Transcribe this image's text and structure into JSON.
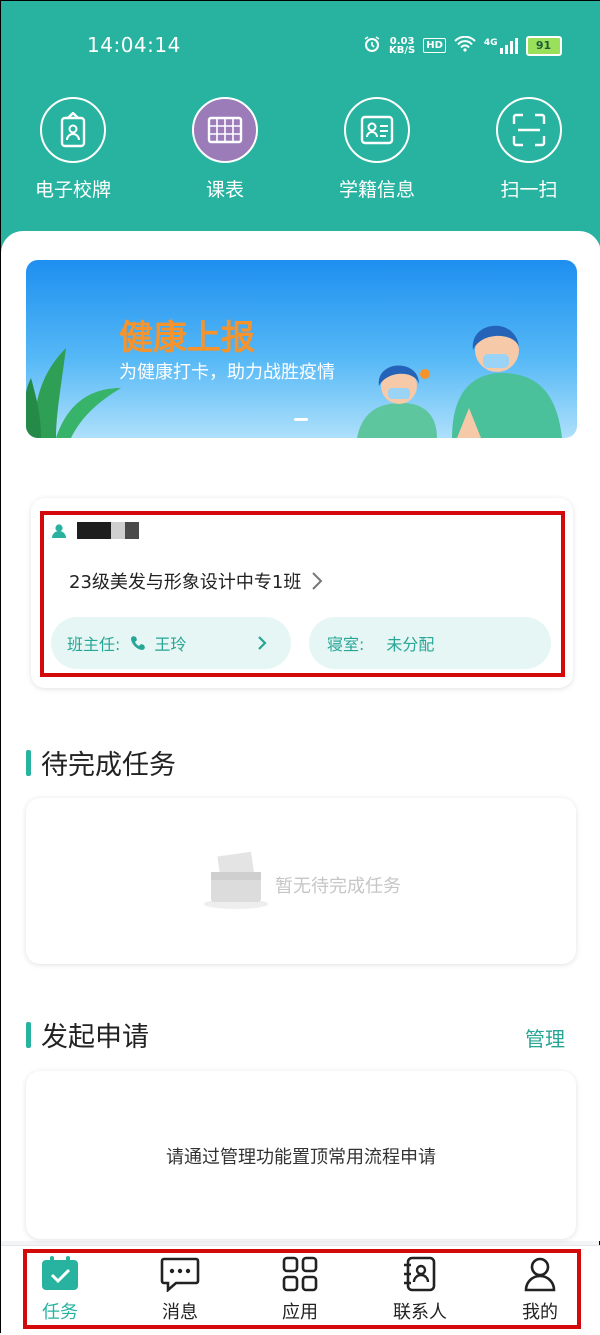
{
  "status_bar": {
    "time": "14:04:14",
    "net_speed_value": "0.03",
    "net_speed_unit": "KB/S",
    "hd": "HD",
    "network": "4G",
    "battery": "91"
  },
  "quick_actions": [
    {
      "label": "电子校牌",
      "icon": "id-badge-icon"
    },
    {
      "label": "课表",
      "icon": "timetable-icon"
    },
    {
      "label": "学籍信息",
      "icon": "student-record-icon"
    },
    {
      "label": "扫一扫",
      "icon": "scan-icon"
    }
  ],
  "banner": {
    "title": "健康上报",
    "subtitle": "为健康打卡，助力战胜疫情"
  },
  "student_card": {
    "class_name": "23级美发与形象设计中专1班",
    "teacher_label": "班主任:",
    "teacher_name": "王玲",
    "dorm_label": "寝室:",
    "dorm_value": "未分配"
  },
  "pending_tasks": {
    "title": "待完成任务",
    "empty_text": "暂无待完成任务"
  },
  "applications": {
    "title": "发起申请",
    "manage_label": "管理",
    "hint": "请通过管理功能置顶常用流程申请"
  },
  "bottom_nav": [
    {
      "label": "任务",
      "icon": "task-icon",
      "active": true
    },
    {
      "label": "消息",
      "icon": "message-icon",
      "active": false
    },
    {
      "label": "应用",
      "icon": "apps-icon",
      "active": false
    },
    {
      "label": "联系人",
      "icon": "contacts-icon",
      "active": false
    },
    {
      "label": "我的",
      "icon": "profile-icon",
      "active": false
    }
  ],
  "colors": {
    "primary": "#27b3a0",
    "accent_orange": "#f7932b",
    "highlight_red": "#d40a0a"
  }
}
